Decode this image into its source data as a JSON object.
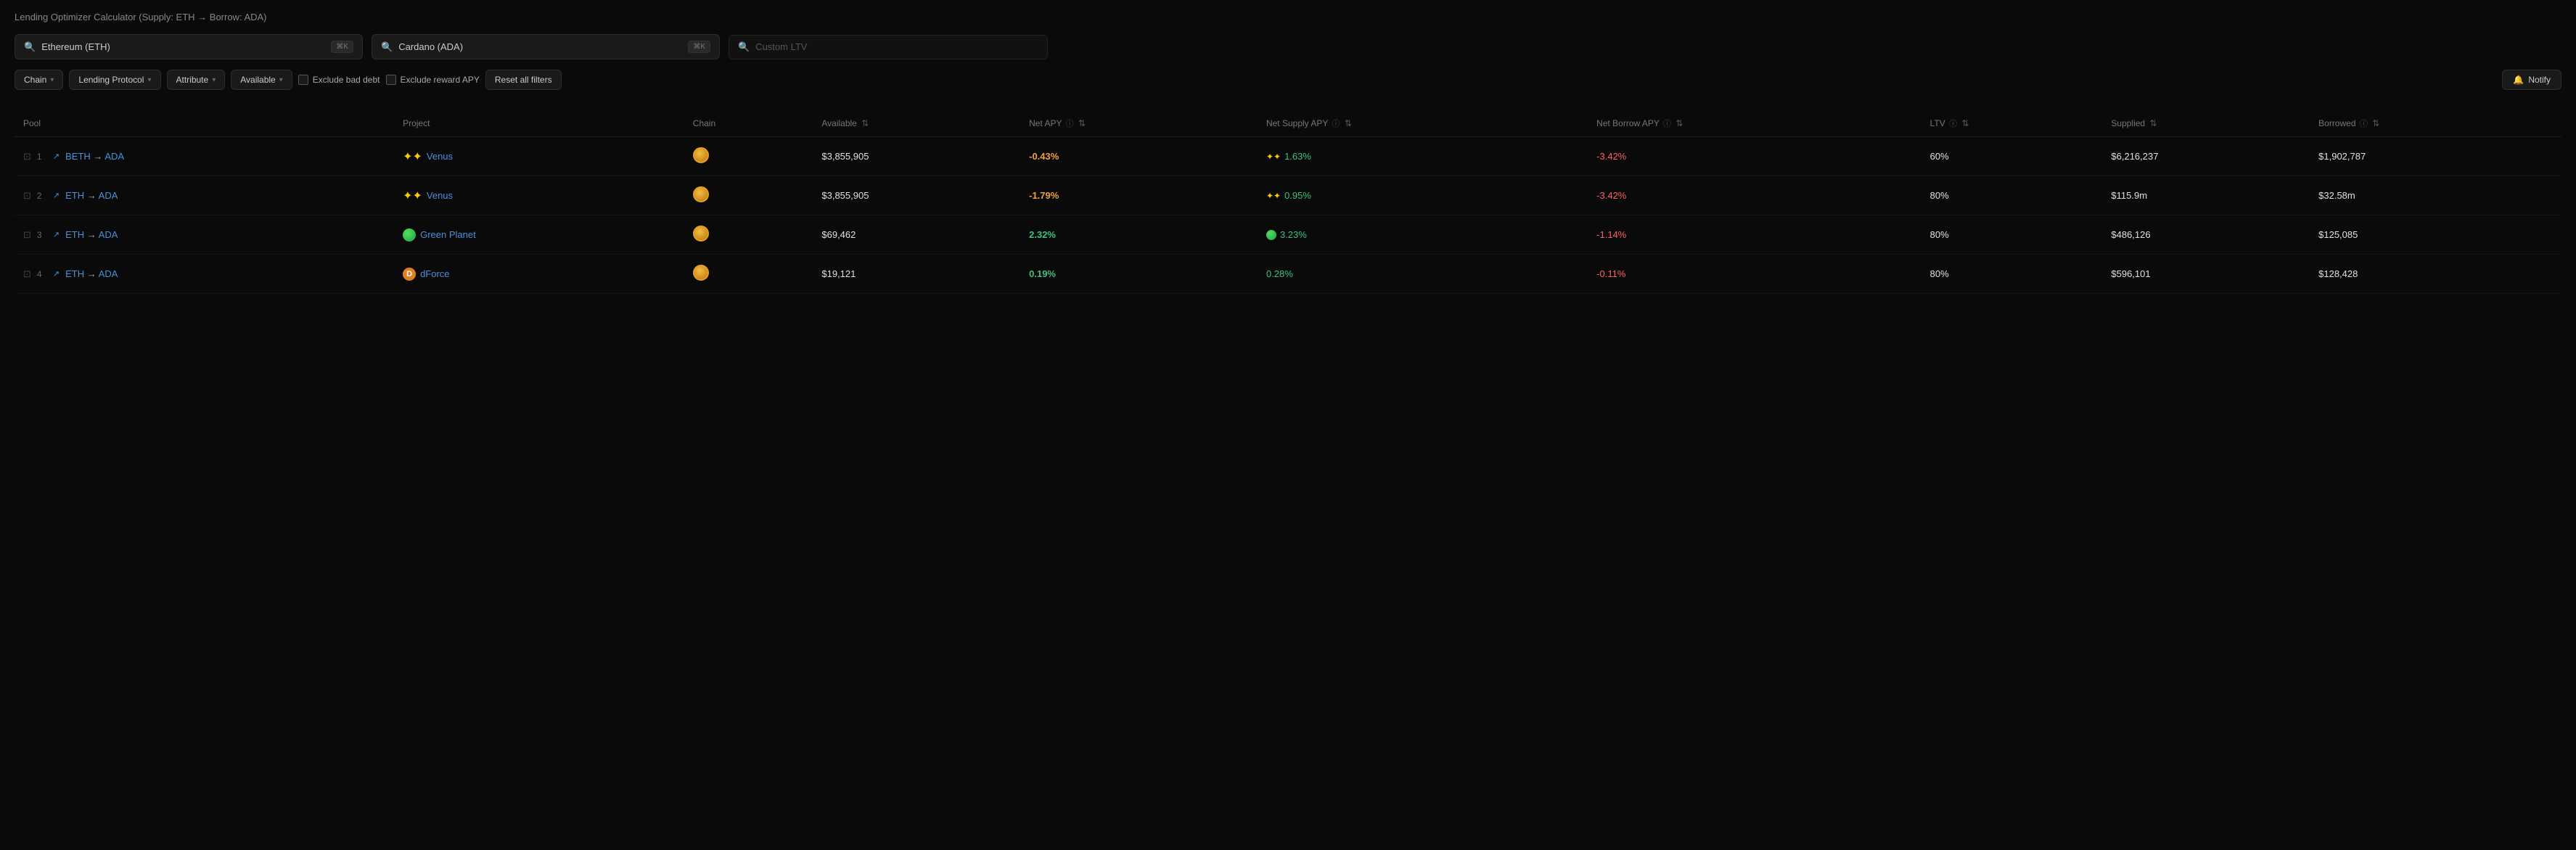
{
  "page": {
    "title": "Lending Optimizer Calculator (Supply: ETH → Borrow: ADA)"
  },
  "search": {
    "supply_placeholder": "Ethereum (ETH)",
    "borrow_placeholder": "Cardano (ADA)",
    "ltv_placeholder": "Custom LTV",
    "supply_kbd": "⌘K",
    "borrow_kbd": "⌘K"
  },
  "filters": {
    "chain_label": "Chain",
    "lending_protocol_label": "Lending Protocol",
    "attribute_label": "Attribute",
    "available_label": "Available",
    "exclude_bad_debt_label": "Exclude bad debt",
    "exclude_reward_apy_label": "Exclude reward APY",
    "reset_label": "Reset all filters",
    "notify_label": "Notify"
  },
  "table": {
    "headers": [
      {
        "id": "pool",
        "label": "Pool"
      },
      {
        "id": "project",
        "label": "Project"
      },
      {
        "id": "chain",
        "label": "Chain"
      },
      {
        "id": "available",
        "label": "Available",
        "sortable": true
      },
      {
        "id": "net_apy",
        "label": "Net APY",
        "info": true,
        "sortable": true
      },
      {
        "id": "net_supply_apy",
        "label": "Net Supply APY",
        "info": true,
        "sortable": true
      },
      {
        "id": "net_borrow_apy",
        "label": "Net Borrow APY",
        "info": true,
        "sortable": true
      },
      {
        "id": "ltv",
        "label": "LTV",
        "info": true,
        "sortable": true
      },
      {
        "id": "supplied",
        "label": "Supplied",
        "sortable": true
      },
      {
        "id": "borrowed",
        "label": "Borrowed",
        "info": true,
        "sortable": true
      }
    ],
    "rows": [
      {
        "rank": "1",
        "pool_name": "BETH → ADA",
        "project": "Venus",
        "project_type": "venus",
        "available": "$3,855,905",
        "net_apy": "-0.43%",
        "net_apy_type": "neg",
        "net_supply_apy": "1.63%",
        "net_supply_apy_type": "pos",
        "net_borrow_apy": "-3.42%",
        "net_borrow_apy_type": "neg",
        "ltv": "60%",
        "supplied": "$6,216,237",
        "borrowed": "$1,902,787"
      },
      {
        "rank": "2",
        "pool_name": "ETH → ADA",
        "project": "Venus",
        "project_type": "venus",
        "available": "$3,855,905",
        "net_apy": "-1.79%",
        "net_apy_type": "neg",
        "net_supply_apy": "0.95%",
        "net_supply_apy_type": "pos",
        "net_borrow_apy": "-3.42%",
        "net_borrow_apy_type": "neg",
        "ltv": "80%",
        "supplied": "$115.9m",
        "borrowed": "$32.58m"
      },
      {
        "rank": "3",
        "pool_name": "ETH → ADA",
        "project": "Green Planet",
        "project_type": "green_planet",
        "available": "$69,462",
        "net_apy": "2.32%",
        "net_apy_type": "pos",
        "net_supply_apy": "3.23%",
        "net_supply_apy_type": "pos",
        "net_borrow_apy": "-1.14%",
        "net_borrow_apy_type": "neg",
        "ltv": "80%",
        "supplied": "$486,126",
        "borrowed": "$125,085"
      },
      {
        "rank": "4",
        "pool_name": "ETH → ADA",
        "project": "dForce",
        "project_type": "dforce",
        "available": "$19,121",
        "net_apy": "0.19%",
        "net_apy_type": "pos",
        "net_supply_apy": "0.28%",
        "net_supply_apy_type": "pos",
        "net_borrow_apy": "-0.11%",
        "net_borrow_apy_type": "neg",
        "ltv": "80%",
        "supplied": "$596,101",
        "borrowed": "$128,428"
      }
    ]
  }
}
